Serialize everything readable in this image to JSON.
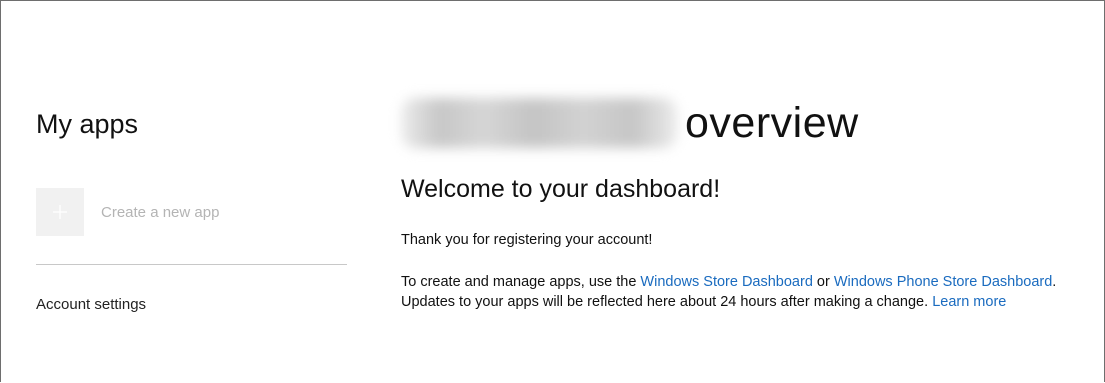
{
  "sidebar": {
    "title": "My apps",
    "create_app_label": "Create a new app",
    "account_settings_label": "Account settings"
  },
  "main": {
    "title_word": "overview",
    "welcome_heading": "Welcome to your dashboard!",
    "thanks_text": "Thank you for registering your account!",
    "info": {
      "intro": "To create and manage apps, use the ",
      "windows_store_link": "Windows Store Dashboard",
      "or_text": " or ",
      "phone_store_link": "Windows Phone Store Dashboard",
      "updates_text": ". Updates to your apps will be reflected here about 24 hours after making a change. ",
      "learn_more_link": "Learn more"
    }
  },
  "colors": {
    "link": "#1a6bbf",
    "muted_text": "#b4b4b4",
    "tile_background": "#f1f1f1"
  },
  "icons": {
    "create_app": "plus-icon"
  }
}
